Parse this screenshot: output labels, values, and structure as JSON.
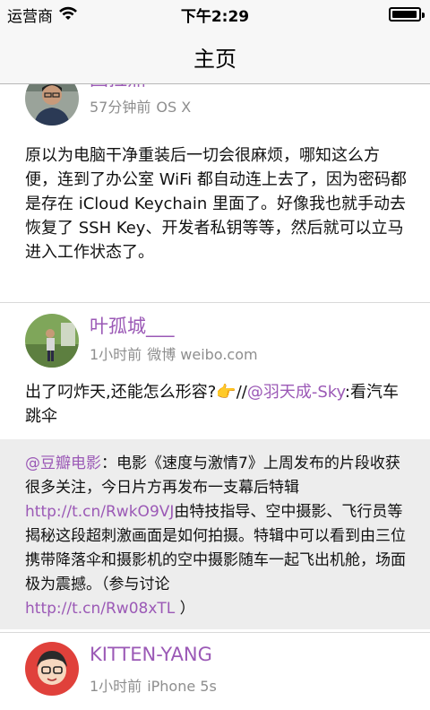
{
  "status_bar": {
    "carrier": "运营商",
    "time": "下午2:29",
    "battery_level": 0.95
  },
  "nav": {
    "title": "主页"
  },
  "feed": {
    "post1": {
      "author": "图拉鼎",
      "time_ago": "57分钟前",
      "source": "OS X",
      "text": "原以为电脑干净重装后一切会很麻烦，哪知这么方便，连到了办公室 WiFi 都自动连上去了，因为密码都是存在 iCloud Keychain 里面了。好像我也就手动去恢复了 SSH Key、开发者私钥等等，然后就可以立马进入工作状态了。"
    },
    "post2": {
      "author": "叶孤城___",
      "time_ago": "1小时前",
      "source": "微博 weibo.com",
      "text_before": "出了叼炸天,还能怎么形容?",
      "emoji": "👉",
      "text_slashes": "//",
      "mention": "@羽天成-Sky",
      "text_after": ":看汽车跳伞",
      "retweet": {
        "mention": "@豆瓣电影",
        "text1": "：电影《速度与激情7》上周发布的片段收获很多关注，今日片方再发布一支幕后特辑",
        "link1": "http://t.cn/RwkO9VJ",
        "text2": "由特技指导、空中摄影、飞行员等揭秘这段超刺激画面是如何拍摄。特辑中可以看到由三位携带降落伞和摄影机的空中摄影随车一起飞出机舱，场面极为震撼。（参与讨论",
        "link2": "http://t.cn/Rw08xTL",
        "text3": "）"
      }
    },
    "post3": {
      "author": "KITTEN-YANG",
      "time_ago": "1小时前",
      "source": "iPhone 5s"
    }
  },
  "colors": {
    "accent": "#9b59b6",
    "meta_gray": "#8e8e8e",
    "retweet_bg": "#ededed"
  }
}
